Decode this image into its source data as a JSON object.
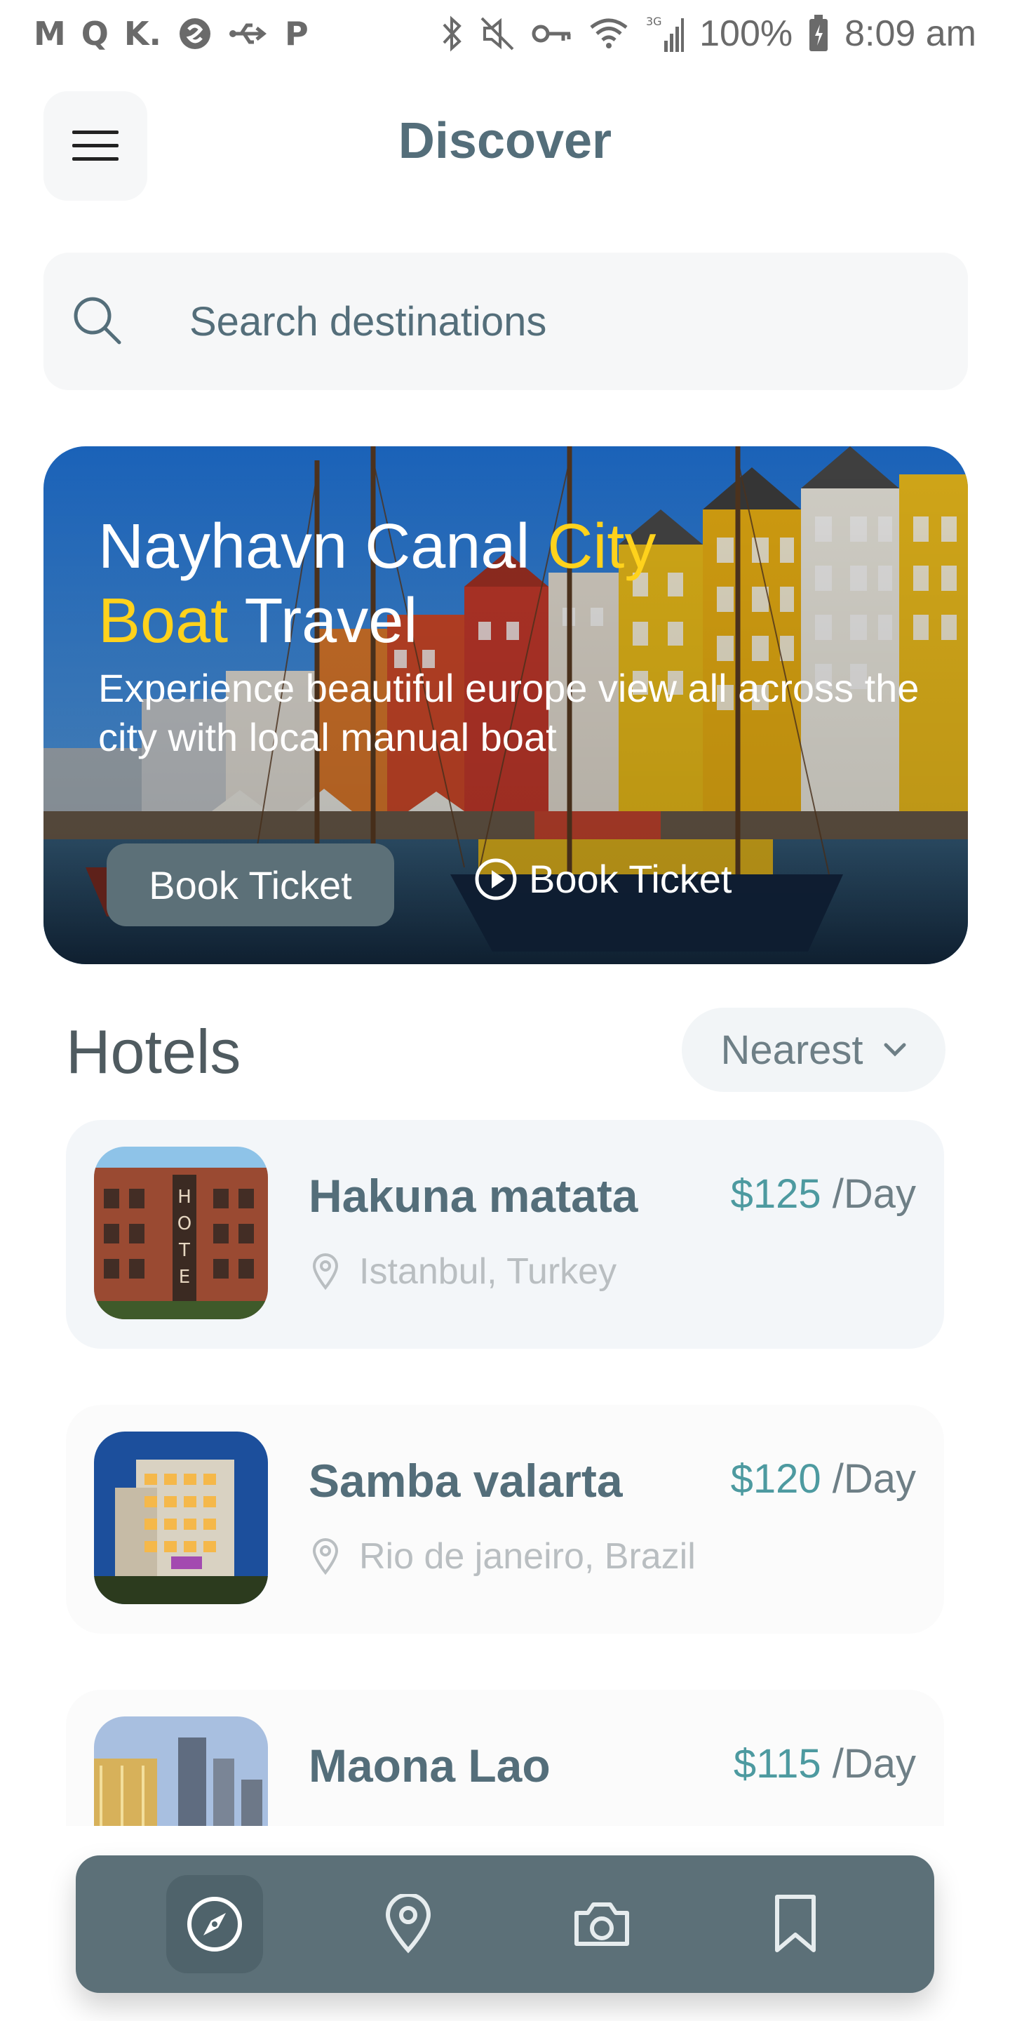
{
  "status_bar": {
    "left_icons": [
      "gmail-icon",
      "q-app-icon",
      "k-app-icon",
      "circle-app-icon",
      "usb-icon",
      "p-app-icon"
    ],
    "right_icons": [
      "bluetooth-icon",
      "mute-icon",
      "key-icon",
      "wifi-icon",
      "signal-icon",
      "battery-icon"
    ],
    "network": "3G",
    "battery": "100%",
    "time": "8:09 am"
  },
  "header": {
    "title": "Discover",
    "menu_icon": "menu-icon"
  },
  "search": {
    "placeholder": "Search destinations",
    "icon": "search-icon"
  },
  "hero": {
    "title_part1": "Nayhavn Canal ",
    "title_highlight1": "City",
    "title_highlight2": "Boat",
    "title_part2": " Travel",
    "subtitle": "Experience beautiful europe view all across the city with local manual boat",
    "primary_button": "Book Ticket",
    "secondary_button": "Book Ticket",
    "highlight_color": "#ffd21c"
  },
  "hotels": {
    "title": "Hotels",
    "sort_label": "Nearest",
    "items": [
      {
        "name": "Hakuna matata",
        "price": "$125",
        "unit": "/Day",
        "location": "Istanbul, Turkey"
      },
      {
        "name": "Samba valarta",
        "price": "$120",
        "unit": "/Day",
        "location": "Rio de janeiro, Brazil"
      },
      {
        "name": "Maona Lao",
        "price": "$115",
        "unit": "/Day",
        "location": ""
      }
    ]
  },
  "bottom_nav": {
    "items": [
      "compass-icon",
      "map-pin-icon",
      "camera-icon",
      "bookmark-icon"
    ],
    "active": "compass-icon"
  },
  "colors": {
    "primary": "#5c7078",
    "accent": "#4d9aa0",
    "text": "#546e7a"
  }
}
